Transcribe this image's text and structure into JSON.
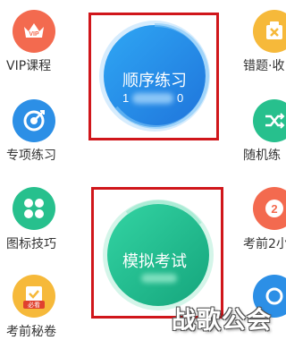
{
  "left_column": [
    {
      "label": "VIP课程",
      "icon": "crown-icon",
      "badge": "VIP",
      "color": "#f36a4f"
    },
    {
      "label": "专项练习",
      "icon": "target-icon",
      "color": "#2c8fe6"
    },
    {
      "label": "图标技巧",
      "icon": "grid-dots-icon",
      "color": "#27c08d"
    },
    {
      "label": "考前秘卷",
      "icon": "scroll-icon",
      "badge": "必看",
      "color": "#f6b93a"
    }
  ],
  "right_column": [
    {
      "label": "错题·收",
      "icon": "close-box-icon",
      "color": "#f6b93a"
    },
    {
      "label": "随机练",
      "icon": "shuffle-icon",
      "color": "#27c08d"
    },
    {
      "label": "考前2小",
      "icon": "clock-icon",
      "badge": "2",
      "color": "#f36a4f"
    },
    {
      "label": "",
      "icon": "partial-icon",
      "color": "#2c8fe6"
    }
  ],
  "center": {
    "sequential": {
      "label": "顺序练习",
      "count_visible": "1",
      "count_tail": "0"
    },
    "mock_exam": {
      "label": "模拟考试"
    }
  },
  "watermark": "战歌公会",
  "colors": {
    "red_frame": "#d0161b",
    "blue": "#2c8fe6",
    "green": "#27c08d"
  }
}
